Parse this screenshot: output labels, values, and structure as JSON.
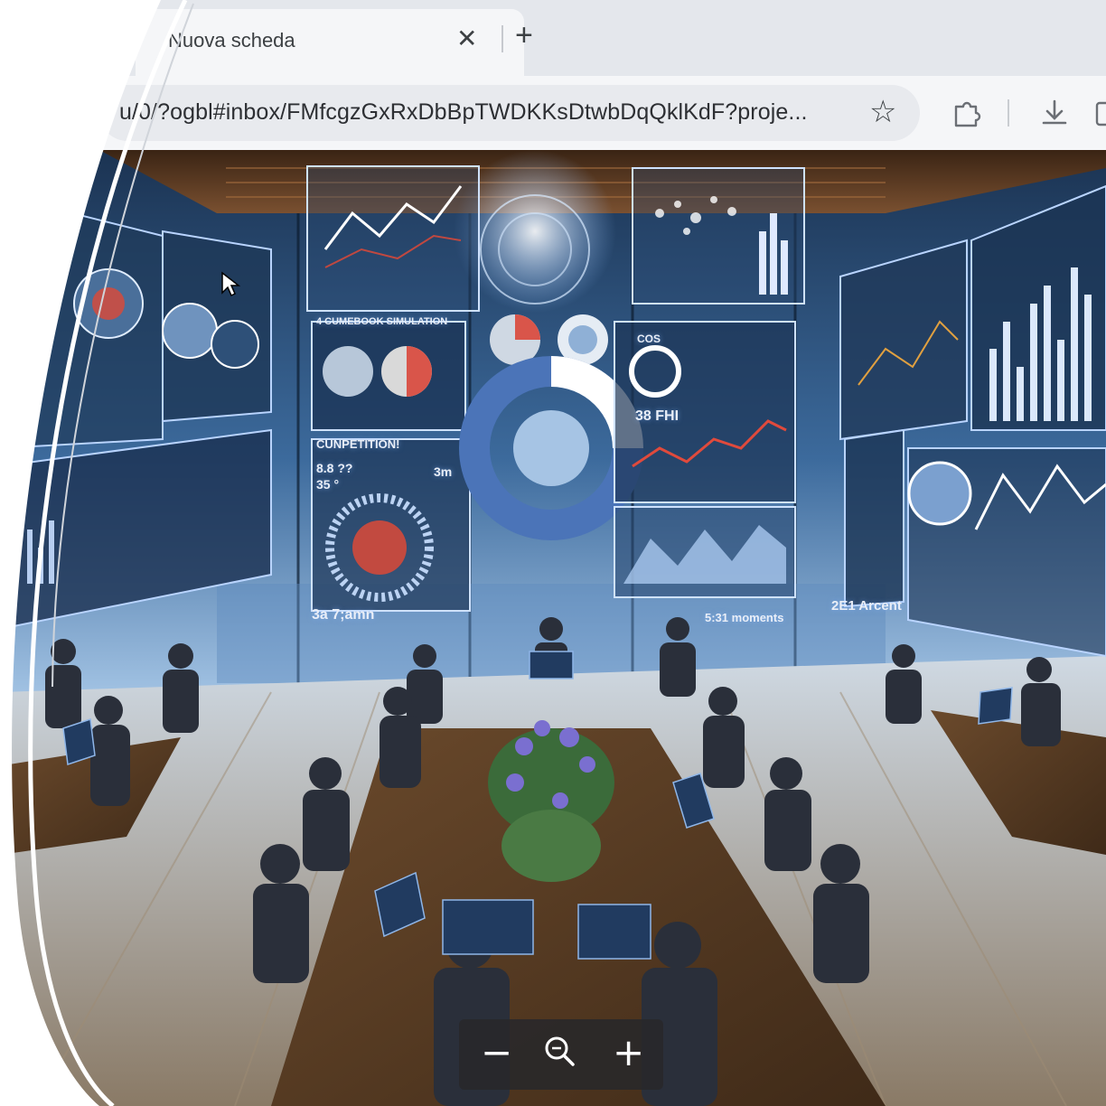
{
  "browser": {
    "tab": {
      "title": "Nuova scheda"
    },
    "url": "u/0/?ogbl#inbox/FMfcgzGxRxDbBpTWDKKsDtwbDqQklKdF?proje...",
    "icons": [
      "star-icon",
      "extension-icon",
      "download-icon"
    ]
  },
  "scene": {
    "panel_labels": {
      "simulation": "4 CUMEBOOK SIMULATION",
      "competition": "CUNPETITION!",
      "metric_a": "8.8 ??",
      "metric_b": "3m",
      "metric_c": "35 °",
      "gauge_label": "38 FHI",
      "cos": "COS",
      "bottom_left": "3a 7;amn",
      "bottom_mid": "5:31 moments",
      "right_tag": "2E1 Arcent"
    }
  },
  "zoom_controls": {
    "minus": "−",
    "magnifier": "magnifier-icon",
    "plus": "+"
  },
  "colors": {
    "tabstrip": "#e4e7ec",
    "toolbar": "#f5f6f8",
    "omnibox": "#e8eaee",
    "scene_bg": "#0f2238",
    "hud": "#9fc6ff",
    "red_accent": "#d9554a"
  }
}
